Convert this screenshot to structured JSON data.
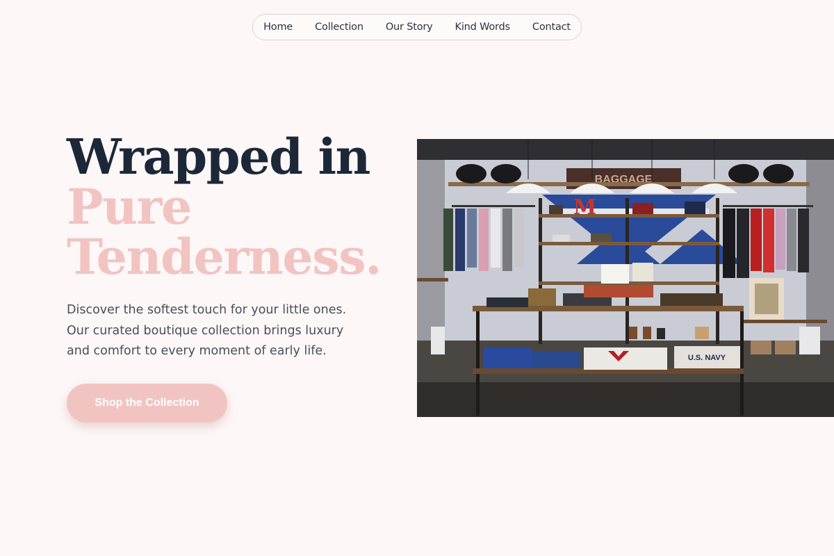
{
  "nav": {
    "items": [
      "Home",
      "Collection",
      "Our Story",
      "Kind Words",
      "Contact"
    ]
  },
  "hero": {
    "title_line1": "Wrapped in",
    "title_line2": "Pure",
    "title_line3": "Tenderness.",
    "description": "Discover the softest touch for your little ones. Our curated boutique collection brings luxury and comfort to every moment of early life.",
    "cta_label": "Shop the Collection"
  },
  "photo": {
    "sign_text": "BAGGAGE",
    "navy_label": "U.S. NAVY"
  },
  "colors": {
    "background": "#fdf7f7",
    "title_dark": "#1c2838",
    "accent_pink": "#f1c4c2",
    "body_text": "#4a4f58"
  }
}
